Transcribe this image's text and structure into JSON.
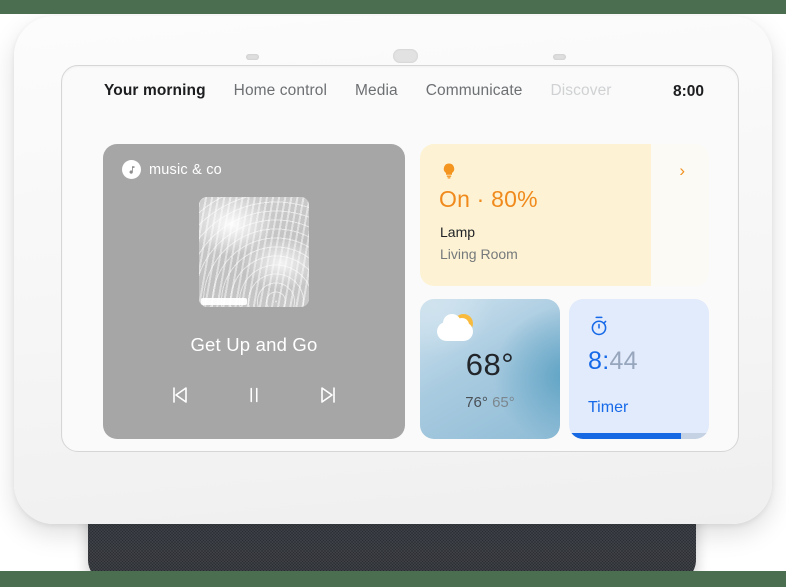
{
  "theme": {
    "band_color": "#4a6e4f",
    "accent_orange": "#f08a1c",
    "accent_blue": "#1669e8",
    "device_body": "#f7f7f7",
    "screen_bg": "#fafafa",
    "media_card_bg": "#a6a6a6"
  },
  "device": {
    "sensors": [
      "sensor-left",
      "sensor-center",
      "sensor-right"
    ],
    "speaker_base": "fabric-mesh-base"
  },
  "screen": {
    "tabs": [
      {
        "label": "Your morning",
        "state": "active"
      },
      {
        "label": "Home control",
        "state": "normal"
      },
      {
        "label": "Media",
        "state": "normal"
      },
      {
        "label": "Communicate",
        "state": "normal"
      },
      {
        "label": "Discover",
        "state": "dimmed"
      }
    ],
    "clock": "8:00"
  },
  "media_card": {
    "provider": "music & co",
    "provider_icon": "music-note-icon",
    "track_title": "Get Up and Go",
    "album_art": "water-ripple-artwork",
    "progress_percent": 42,
    "controls": [
      {
        "name": "previous-track-button",
        "icon": "skip-previous-icon"
      },
      {
        "name": "play-pause-button",
        "icon": "pause-icon"
      },
      {
        "name": "next-track-button",
        "icon": "skip-next-icon"
      }
    ]
  },
  "lamp_card": {
    "icon": "lightbulb-icon",
    "state_line": "On · 80%",
    "brightness_percent": 80,
    "device_name": "Lamp",
    "room": "Living Room",
    "chevron": "›"
  },
  "weather_card": {
    "icon": "partly-cloudy-icon",
    "current_temp": "68°",
    "high_temp": "76°",
    "low_temp": "65°"
  },
  "timer_card": {
    "icon": "stopwatch-icon",
    "time_major": "8:",
    "time_minor": "44",
    "label": "Timer",
    "progress_percent": 80
  }
}
